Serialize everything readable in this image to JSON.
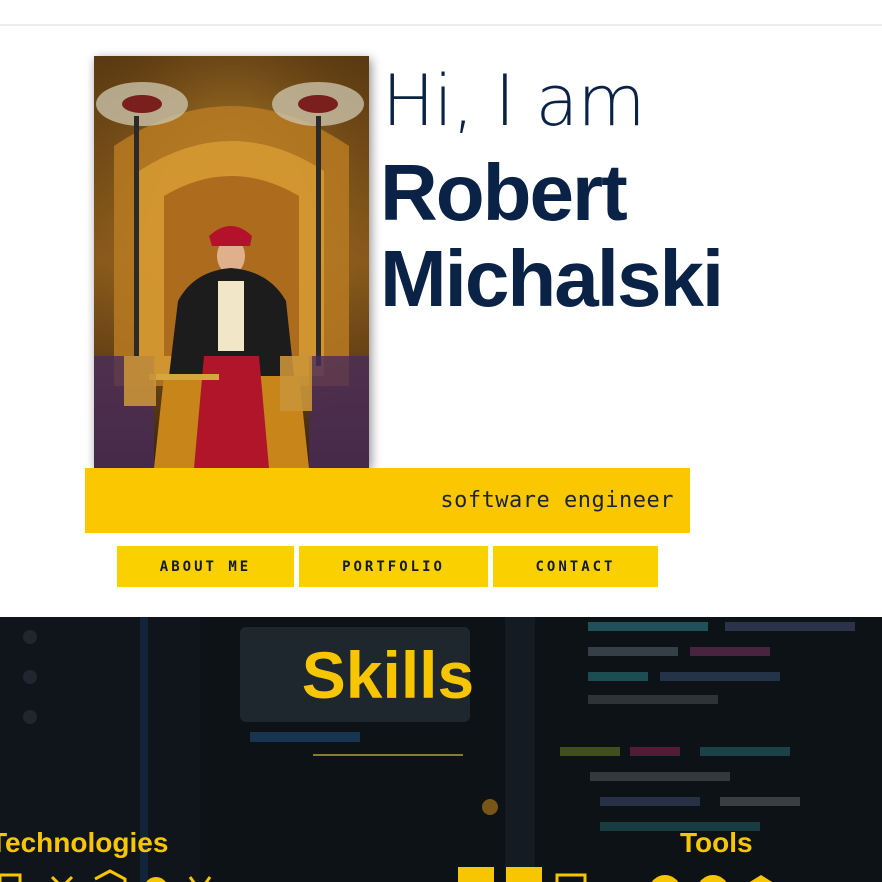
{
  "hero": {
    "greeting": "Hi, I am",
    "first_name": "Robert",
    "last_name": "Michalski",
    "role": "software engineer"
  },
  "nav": {
    "buttons": [
      {
        "label": "ABOUT ME"
      },
      {
        "label": "PORTFOLIO"
      },
      {
        "label": "CONTACT"
      }
    ]
  },
  "skills": {
    "title": "Skills",
    "columns": [
      {
        "title": "Technologies"
      },
      {
        "title": "Tools"
      }
    ]
  },
  "colors": {
    "navy": "#0b2247",
    "accent_yellow": "#fbc700",
    "dark_background": "#12181f"
  }
}
